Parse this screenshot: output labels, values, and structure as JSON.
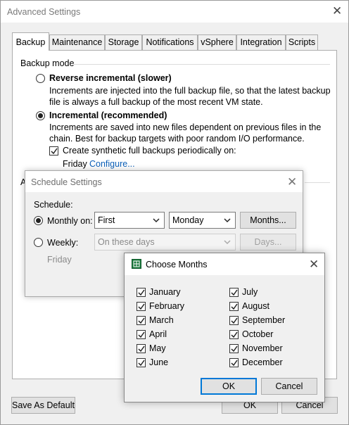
{
  "main": {
    "title": "Advanced Settings",
    "tabs": [
      {
        "label": "Backup"
      },
      {
        "label": "Maintenance"
      },
      {
        "label": "Storage"
      },
      {
        "label": "Notifications"
      },
      {
        "label": "vSphere"
      },
      {
        "label": "Integration"
      },
      {
        "label": "Scripts"
      }
    ],
    "backup_mode": {
      "title": "Backup mode",
      "reverse": {
        "label": "Reverse incremental (slower)",
        "desc1": "Increments are injected into the full backup file, so that the latest backup",
        "desc2": "file is always a full backup of the most recent VM state.",
        "selected": false
      },
      "incremental": {
        "label": "Incremental (recommended)",
        "desc1": "Increments are saved into new files dependent on previous files in the",
        "desc2": "chain. Best for backup targets with poor random I/O performance.",
        "selected": true
      },
      "synthetic": {
        "label": "Create synthetic full backups periodically on:",
        "checked": true,
        "day": "Friday",
        "configure": "Configure..."
      }
    },
    "partial_letter": "A",
    "buttons": {
      "save_default": "Save As Default",
      "ok": "OK",
      "cancel": "Cancel"
    }
  },
  "schedule": {
    "title": "Schedule Settings",
    "schedule_label": "Schedule:",
    "monthly": {
      "label": "Monthly on:",
      "selected": true,
      "week": "First",
      "day": "Monday",
      "months_button": "Months..."
    },
    "weekly": {
      "label": "Weekly:",
      "selected": false,
      "value": "On these days",
      "days_button": "Days...",
      "day_text": "Friday"
    }
  },
  "months": {
    "title": "Choose Months",
    "left": [
      {
        "label": "January",
        "checked": true
      },
      {
        "label": "February",
        "checked": true
      },
      {
        "label": "March",
        "checked": true
      },
      {
        "label": "April",
        "checked": true
      },
      {
        "label": "May",
        "checked": true
      },
      {
        "label": "June",
        "checked": true
      }
    ],
    "right": [
      {
        "label": "July",
        "checked": true
      },
      {
        "label": "August",
        "checked": true
      },
      {
        "label": "September",
        "checked": true
      },
      {
        "label": "October",
        "checked": true
      },
      {
        "label": "November",
        "checked": true
      },
      {
        "label": "December",
        "checked": true
      }
    ],
    "ok": "OK",
    "cancel": "Cancel"
  },
  "icons": {
    "close": "close-icon",
    "chevron": "chevron-down-icon",
    "check": "check-icon",
    "app": "veeam-app-icon"
  },
  "colors": {
    "link": "#0b5fb8",
    "focus": "#0078d7",
    "app_icon": "#1b7a3d"
  }
}
